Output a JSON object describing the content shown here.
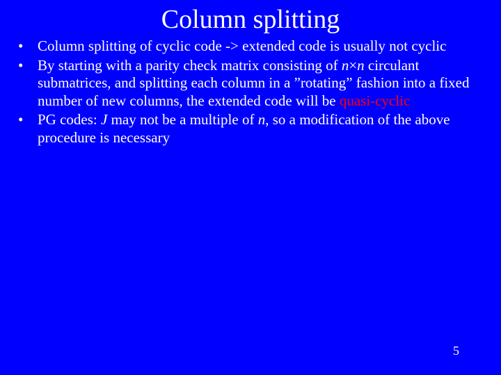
{
  "title": "Column splitting",
  "bullets": {
    "b1": "Column splitting of cyclic code -> extended code is usually not cyclic",
    "b2a": "By starting with a parity check matrix consisting of ",
    "b2_n1": "n",
    "b2_times": "×",
    "b2_n2": "n",
    "b2b": " circulant submatrices, and splitting each column in a ”rotating” fashion into a fixed number of new columns, the extended code will be ",
    "b2_qc": "quasi-cyclic",
    "b3a": "PG codes: ",
    "b3_J": "J",
    "b3b": " may not be a multiple of ",
    "b3_n": "n",
    "b3c": ", so a modification of the above procedure is necessary"
  },
  "page_number": "5"
}
